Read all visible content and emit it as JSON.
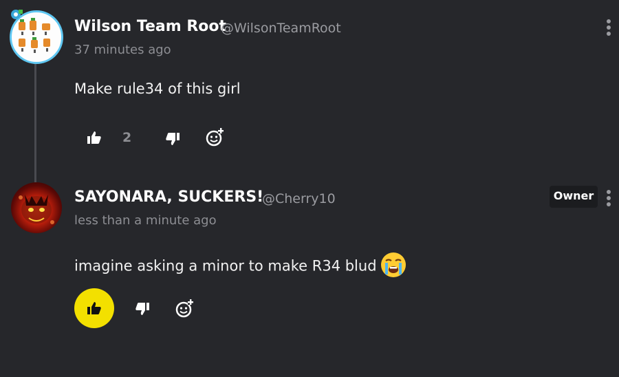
{
  "comments": [
    {
      "author_name": "Wilson Team Root",
      "handle": "@WilsonTeamRoot",
      "time": "37 minutes ago",
      "text": "Make rule34 of this girl",
      "like_count": "2",
      "liked": false,
      "owner_badge": ""
    },
    {
      "author_name": "SAYONARA, SUCKERS!",
      "handle": "@Cherry10",
      "time": "less than a minute ago",
      "text": "imagine asking a minor to make R34 blud",
      "emoji": "loudly-crying-face",
      "liked": true,
      "owner_badge": "Owner"
    }
  ],
  "colors": {
    "background": "#26272b",
    "like_active": "#f3e000",
    "avatar_ring": "#5fc7f2",
    "muted_text": "#8d8e93"
  }
}
